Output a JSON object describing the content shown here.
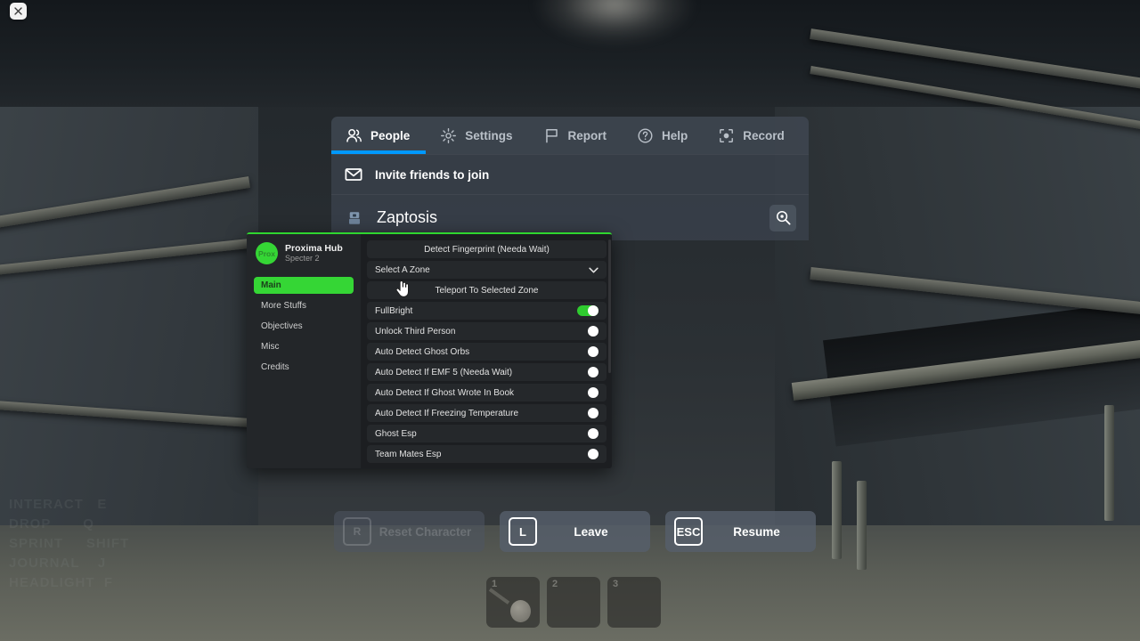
{
  "window": {
    "close_label": "×"
  },
  "scene": {
    "keybind_legend": "INTERACT   E\nDROP       Q\nSPRINT     SHIFT\nJOURNAL    J\nHEADLIGHT  F"
  },
  "escape_menu": {
    "tabs": [
      {
        "label": "People",
        "icon": "people-icon",
        "active": true
      },
      {
        "label": "Settings",
        "icon": "gear-icon",
        "active": false
      },
      {
        "label": "Report",
        "icon": "flag-icon",
        "active": false
      },
      {
        "label": "Help",
        "icon": "question-icon",
        "active": false
      },
      {
        "label": "Record",
        "icon": "record-icon",
        "active": false
      }
    ],
    "active_tab_accent": "#0099ff",
    "invite_row": {
      "label": "Invite friends to join",
      "icon": "envelope-icon"
    },
    "player_row": {
      "name": "Zaptosis",
      "icon": "avatar-icon",
      "inspect_icon": "magnifier-eye-icon"
    },
    "actions": [
      {
        "key": "R",
        "label": "Reset Character",
        "disabled": true
      },
      {
        "key": "L",
        "label": "Leave",
        "disabled": false
      },
      {
        "key": "ESC",
        "label": "Resume",
        "disabled": false
      }
    ]
  },
  "hotbar": {
    "slots": [
      {
        "number": "1",
        "has_item": true
      },
      {
        "number": "2",
        "has_item": false
      },
      {
        "number": "3",
        "has_item": false
      }
    ]
  },
  "script_hub": {
    "accent_color": "#35d635",
    "brand": {
      "logo_text": "Prox",
      "name": "Proxima Hub",
      "subtitle": "Specter 2"
    },
    "nav": [
      {
        "label": "Main",
        "active": true
      },
      {
        "label": "More Stuffs",
        "active": false
      },
      {
        "label": "Objectives",
        "active": false
      },
      {
        "label": "Misc",
        "active": false
      },
      {
        "label": "Credits",
        "active": false
      }
    ],
    "controls": [
      {
        "type": "button",
        "label": "Detect Fingerprint (Needa Wait)"
      },
      {
        "type": "dropdown",
        "label": "Select A Zone",
        "icon": "chevron-down-icon"
      },
      {
        "type": "button",
        "label": "Teleport To Selected Zone"
      },
      {
        "type": "toggle",
        "label": "FullBright",
        "on": true
      },
      {
        "type": "toggle",
        "label": "Unlock Third Person",
        "on": false
      },
      {
        "type": "toggle",
        "label": "Auto Detect Ghost Orbs",
        "on": false
      },
      {
        "type": "toggle",
        "label": "Auto Detect If EMF 5 (Needa Wait)",
        "on": false
      },
      {
        "type": "toggle",
        "label": "Auto Detect If Ghost Wrote In Book",
        "on": false
      },
      {
        "type": "toggle",
        "label": "Auto Detect If Freezing Temperature",
        "on": false
      },
      {
        "type": "toggle",
        "label": "Ghost Esp",
        "on": false
      },
      {
        "type": "toggle",
        "label": "Team Mates Esp",
        "on": false
      }
    ]
  }
}
